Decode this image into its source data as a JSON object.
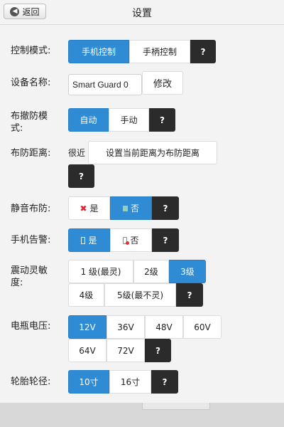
{
  "header": {
    "back_label": "返回",
    "title": "设置"
  },
  "control_mode": {
    "label": "控制模式:",
    "options": [
      "手机控制",
      "手柄控制"
    ],
    "selected": "手机控制",
    "help": "?"
  },
  "device_name": {
    "label": "设备名称:",
    "value": "Smart Guard 0",
    "modify_label": "修改"
  },
  "arm_mode": {
    "label": "布撤防模式:",
    "options": [
      "自动",
      "手动"
    ],
    "selected": "自动",
    "help": "?"
  },
  "arm_distance": {
    "label": "布防距离:",
    "value": "很近",
    "set_label": "设置当前距离为布防距离",
    "help": "?"
  },
  "silent_arm": {
    "label": "静音布防:",
    "options": [
      "是",
      "否"
    ],
    "selected": "否",
    "help": "?"
  },
  "phone_alert": {
    "label": "手机告警:",
    "options": [
      "是",
      "否"
    ],
    "selected": "是",
    "help": "?"
  },
  "vibration": {
    "label": "震动灵敏度:",
    "options": [
      "1 级(最灵)",
      "2级",
      "3级",
      "4级",
      "5级(最不灵)"
    ],
    "selected": "3级",
    "help": "?"
  },
  "battery_voltage": {
    "label": "电瓶电压:",
    "options": [
      "12V",
      "36V",
      "48V",
      "60V",
      "64V",
      "72V"
    ],
    "selected": "12V",
    "help": "?"
  },
  "tire_size": {
    "label": "轮胎轮径:",
    "options": [
      "10寸",
      "16寸"
    ],
    "selected": "10寸",
    "help": "?"
  },
  "icons": [
    "back-arrow-icon",
    "x-icon",
    "mute-icon",
    "phone-icon",
    "phone-off-icon"
  ],
  "colors": {
    "accent": "#2f8bd3",
    "help_bg": "#2b2b2b",
    "background": "#f3f3f3"
  }
}
